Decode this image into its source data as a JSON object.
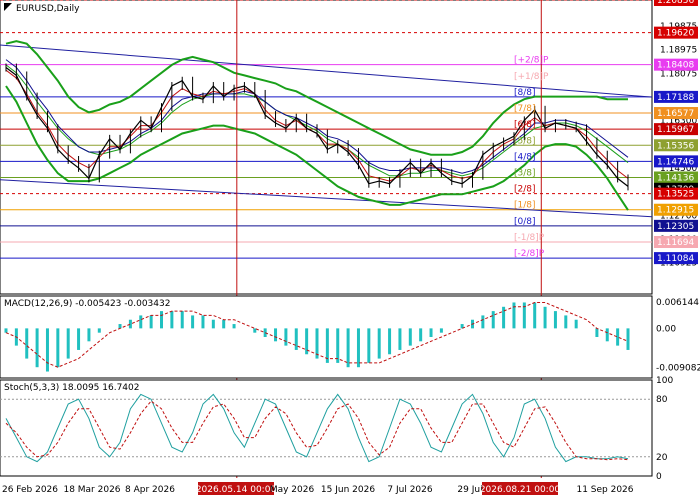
{
  "chart_data": [
    {
      "type": "line",
      "title": "EURUSD,Daily",
      "y_range": [
        1.09725,
        1.20856
      ],
      "x_date_range": [
        "2026-02-26",
        "2026-09-26"
      ],
      "price_axis_ticks": [
        "1.20856",
        "1.19875",
        "1.18975",
        "1.18075",
        "1.17188",
        "1.16300",
        "1.15400",
        "1.14500",
        "1.13709",
        "1.12700",
        "1.11800",
        "1.10925"
      ],
      "level_labels": [
        {
          "price": 1.20856,
          "text": "1.20856",
          "color": "#d60000"
        },
        {
          "price": 1.1962,
          "text": "1.19620",
          "color": "#d60000"
        },
        {
          "price": 1.18408,
          "text": "1.18408",
          "color": "#e83cf0"
        },
        {
          "price": 1.17188,
          "text": "1.17188",
          "color": "#1818c8"
        },
        {
          "price": 1.16577,
          "text": "1.16577",
          "color": "#f09020"
        },
        {
          "price": 1.15967,
          "text": "1.15967",
          "color": "#c80000"
        },
        {
          "price": 1.15356,
          "text": "1.15356",
          "color": "#8ea030"
        },
        {
          "price": 1.14746,
          "text": "1.14746",
          "color": "#1818c8"
        },
        {
          "price": 1.14136,
          "text": "1.14136",
          "color": "#6aa020"
        },
        {
          "price": 1.13709,
          "text": "1.13709",
          "color": "#000000"
        },
        {
          "price": 1.13525,
          "text": "1.13525",
          "color": "#d60000"
        },
        {
          "price": 1.12915,
          "text": "1.12915",
          "color": "#f0a000"
        },
        {
          "price": 1.12305,
          "text": "1.12305",
          "color": "#101090"
        },
        {
          "price": 1.11694,
          "text": "1.11694",
          "color": "#f6a8b0"
        },
        {
          "price": 1.11084,
          "text": "1.11084",
          "color": "#1818c8"
        }
      ],
      "murrey_labels": [
        {
          "price": 1.18408,
          "text": "[+2/8]P",
          "color": "#e83cf0"
        },
        {
          "price": 1.17798,
          "text": "[+1/8]P",
          "color": "#f6a8b0"
        },
        {
          "price": 1.17188,
          "text": "[8/8]",
          "color": "#1818c8"
        },
        {
          "price": 1.16577,
          "text": "[7/8]",
          "color": "#f09020"
        },
        {
          "price": 1.15967,
          "text": "[6/8]",
          "color": "#c80000"
        },
        {
          "price": 1.15356,
          "text": "[5/8]",
          "color": "#8ea030"
        },
        {
          "price": 1.14746,
          "text": "[4/8]",
          "color": "#1818c8"
        },
        {
          "price": 1.14136,
          "text": "[3/8]",
          "color": "#6aa020"
        },
        {
          "price": 1.13525,
          "text": "[2/8]",
          "color": "#c80000"
        },
        {
          "price": 1.12915,
          "text": "[1/8]",
          "color": "#f09020"
        },
        {
          "price": 1.12305,
          "text": "[0/8]",
          "color": "#1818c8"
        },
        {
          "price": 1.11694,
          "text": "[-1/8]P",
          "color": "#f6a8b0"
        },
        {
          "price": 1.11084,
          "text": "[-2/8]P",
          "color": "#e83cf0"
        }
      ],
      "series": [
        {
          "kind": "close",
          "values": [
            1.183,
            1.18,
            1.172,
            1.165,
            1.16,
            1.152,
            1.148,
            1.145,
            1.141,
            1.15,
            1.156,
            1.152,
            1.158,
            1.163,
            1.16,
            1.168,
            1.176,
            1.178,
            1.172,
            1.171,
            1.176,
            1.172,
            1.175,
            1.176,
            1.173,
            1.165,
            1.162,
            1.16,
            1.164,
            1.16,
            1.158,
            1.152,
            1.154,
            1.151,
            1.146,
            1.139,
            1.14,
            1.139,
            1.143,
            1.147,
            1.143,
            1.147,
            1.143,
            1.14,
            1.139,
            1.142,
            1.15,
            1.153,
            1.155,
            1.157,
            1.163,
            1.167,
            1.16,
            1.162,
            1.161,
            1.16,
            1.155,
            1.15,
            1.146,
            1.141,
            1.138
          ]
        },
        {
          "kind": "tenkan",
          "values": [
            1.182,
            1.179,
            1.173,
            1.166,
            1.161,
            1.154,
            1.15,
            1.147,
            1.145,
            1.149,
            1.153,
            1.153,
            1.157,
            1.161,
            1.161,
            1.166,
            1.172,
            1.175,
            1.173,
            1.172,
            1.174,
            1.173,
            1.174,
            1.175,
            1.173,
            1.167,
            1.163,
            1.161,
            1.163,
            1.16,
            1.158,
            1.154,
            1.154,
            1.152,
            1.148,
            1.142,
            1.141,
            1.14,
            1.142,
            1.145,
            1.144,
            1.146,
            1.144,
            1.142,
            1.141,
            1.142,
            1.147,
            1.151,
            1.154,
            1.156,
            1.161,
            1.164,
            1.161,
            1.162,
            1.161,
            1.16,
            1.157,
            1.152,
            1.148,
            1.144,
            1.141
          ]
        },
        {
          "kind": "kijun",
          "values": [
            1.186,
            1.183,
            1.178,
            1.172,
            1.167,
            1.161,
            1.157,
            1.153,
            1.151,
            1.151,
            1.152,
            1.153,
            1.155,
            1.158,
            1.16,
            1.163,
            1.168,
            1.171,
            1.172,
            1.173,
            1.173,
            1.173,
            1.173,
            1.174,
            1.173,
            1.17,
            1.167,
            1.165,
            1.164,
            1.162,
            1.16,
            1.157,
            1.156,
            1.154,
            1.151,
            1.147,
            1.145,
            1.144,
            1.144,
            1.145,
            1.145,
            1.145,
            1.145,
            1.144,
            1.143,
            1.144,
            1.146,
            1.149,
            1.152,
            1.155,
            1.158,
            1.162,
            1.162,
            1.163,
            1.163,
            1.162,
            1.161,
            1.158,
            1.155,
            1.152,
            1.149
          ]
        },
        {
          "kind": "bb_mid",
          "values": [
            1.184,
            1.181,
            1.176,
            1.17,
            1.165,
            1.16,
            1.156,
            1.153,
            1.151,
            1.15,
            1.151,
            1.152,
            1.154,
            1.157,
            1.159,
            1.162,
            1.166,
            1.169,
            1.171,
            1.172,
            1.173,
            1.173,
            1.173,
            1.173,
            1.172,
            1.17,
            1.167,
            1.165,
            1.163,
            1.161,
            1.159,
            1.156,
            1.154,
            1.152,
            1.149,
            1.146,
            1.144,
            1.142,
            1.142,
            1.143,
            1.143,
            1.144,
            1.144,
            1.143,
            1.142,
            1.143,
            1.145,
            1.148,
            1.151,
            1.154,
            1.157,
            1.16,
            1.161,
            1.162,
            1.162,
            1.161,
            1.159,
            1.156,
            1.153,
            1.15,
            1.147
          ]
        },
        {
          "kind": "bb_upper",
          "values": [
            1.192,
            1.193,
            1.192,
            1.188,
            1.183,
            1.178,
            1.172,
            1.168,
            1.166,
            1.167,
            1.169,
            1.17,
            1.172,
            1.175,
            1.178,
            1.181,
            1.184,
            1.186,
            1.187,
            1.186,
            1.185,
            1.183,
            1.181,
            1.18,
            1.179,
            1.178,
            1.177,
            1.175,
            1.174,
            1.172,
            1.17,
            1.168,
            1.166,
            1.164,
            1.162,
            1.16,
            1.158,
            1.156,
            1.154,
            1.152,
            1.151,
            1.15,
            1.15,
            1.15,
            1.151,
            1.153,
            1.157,
            1.162,
            1.166,
            1.169,
            1.171,
            1.172,
            1.172,
            1.172,
            1.172,
            1.172,
            1.172,
            1.172,
            1.171,
            1.171,
            1.171
          ]
        },
        {
          "kind": "bb_lower",
          "values": [
            1.176,
            1.17,
            1.162,
            1.154,
            1.148,
            1.143,
            1.14,
            1.14,
            1.14,
            1.141,
            1.143,
            1.145,
            1.147,
            1.15,
            1.152,
            1.154,
            1.156,
            1.158,
            1.159,
            1.16,
            1.161,
            1.161,
            1.16,
            1.159,
            1.158,
            1.156,
            1.154,
            1.152,
            1.15,
            1.147,
            1.144,
            1.141,
            1.138,
            1.136,
            1.134,
            1.133,
            1.132,
            1.131,
            1.131,
            1.132,
            1.133,
            1.134,
            1.135,
            1.135,
            1.135,
            1.136,
            1.137,
            1.138,
            1.14,
            1.143,
            1.146,
            1.15,
            1.153,
            1.154,
            1.154,
            1.153,
            1.15,
            1.146,
            1.141,
            1.135,
            1.129
          ]
        }
      ],
      "price_channel": {
        "upper": [
          1.1915,
          1.1718
        ],
        "lower": [
          1.1405,
          1.1265
        ]
      },
      "vlines": [
        {
          "label": "2026.05.14 00:00",
          "date": "2026-05-14"
        },
        {
          "label": "2026.08.21 00:00",
          "date": "2026-08-21"
        }
      ],
      "x_tick_labels": [
        "26 Feb 2026",
        "18 Mar 2026",
        "8 Apr 2026",
        "2026.05.14 00:00",
        "May 2026",
        "15 Jun 2026",
        "7 Jul 2026",
        "29 Jul",
        "2026.08.21 00:00",
        "11 Sep 2026"
      ]
    },
    {
      "type": "bar",
      "title": "MACD(12,26,9) -0.005423 -0.003432",
      "y_ticks": [
        "0.006144",
        "0.00",
        "-0.009082"
      ],
      "y_range": [
        -0.0115,
        0.0075
      ],
      "series": [
        {
          "name": "MACD",
          "values": [
            -0.001,
            -0.004,
            -0.007,
            -0.009,
            -0.01,
            -0.009,
            -0.007,
            -0.005,
            -0.003,
            -0.001,
            0.0,
            0.001,
            0.002,
            0.003,
            0.003,
            0.004,
            0.004,
            0.004,
            0.003,
            0.003,
            0.002,
            0.002,
            0.001,
            0.0,
            -0.001,
            -0.002,
            -0.003,
            -0.004,
            -0.005,
            -0.006,
            -0.007,
            -0.008,
            -0.008,
            -0.009,
            -0.009,
            -0.008,
            -0.007,
            -0.006,
            -0.005,
            -0.004,
            -0.003,
            -0.002,
            -0.001,
            0.0,
            0.001,
            0.002,
            0.003,
            0.004,
            0.005,
            0.006,
            0.006,
            0.006,
            0.005,
            0.004,
            0.003,
            0.002,
            0.0,
            -0.002,
            -0.003,
            -0.004,
            -0.005
          ]
        },
        {
          "name": "Signal",
          "values": [
            -0.001,
            -0.002,
            -0.004,
            -0.006,
            -0.008,
            -0.009,
            -0.008,
            -0.007,
            -0.005,
            -0.003,
            -0.001,
            0.0,
            0.001,
            0.002,
            0.003,
            0.003,
            0.004,
            0.004,
            0.004,
            0.003,
            0.003,
            0.002,
            0.002,
            0.001,
            0.0,
            -0.001,
            -0.002,
            -0.003,
            -0.004,
            -0.005,
            -0.006,
            -0.007,
            -0.007,
            -0.008,
            -0.008,
            -0.008,
            -0.008,
            -0.007,
            -0.006,
            -0.005,
            -0.004,
            -0.003,
            -0.002,
            -0.001,
            0.0,
            0.001,
            0.002,
            0.003,
            0.004,
            0.005,
            0.005,
            0.006,
            0.006,
            0.005,
            0.004,
            0.003,
            0.002,
            0.0,
            -0.001,
            -0.002,
            -0.003
          ]
        }
      ]
    },
    {
      "type": "line",
      "title": "Stoch(5,3,3) 18.0095 16.7402",
      "y_ticks": [
        "100",
        "80",
        "20",
        "0"
      ],
      "y_range": [
        0,
        100
      ],
      "series": [
        {
          "name": "Main",
          "values": [
            60,
            40,
            20,
            15,
            25,
            50,
            75,
            80,
            60,
            30,
            20,
            35,
            70,
            85,
            80,
            55,
            30,
            25,
            45,
            75,
            85,
            70,
            45,
            30,
            55,
            80,
            75,
            50,
            25,
            20,
            45,
            70,
            85,
            70,
            40,
            15,
            20,
            50,
            80,
            75,
            55,
            30,
            25,
            50,
            75,
            85,
            65,
            35,
            20,
            40,
            75,
            80,
            60,
            30,
            15,
            20,
            20,
            18,
            18,
            20,
            18
          ]
        },
        {
          "name": "Signal",
          "values": [
            55,
            45,
            30,
            20,
            22,
            35,
            55,
            70,
            70,
            50,
            30,
            28,
            45,
            65,
            78,
            70,
            50,
            35,
            35,
            55,
            72,
            75,
            60,
            40,
            40,
            60,
            72,
            65,
            45,
            30,
            32,
            50,
            70,
            75,
            60,
            35,
            22,
            30,
            55,
            70,
            70,
            50,
            35,
            35,
            55,
            75,
            75,
            55,
            35,
            30,
            50,
            70,
            72,
            55,
            35,
            20,
            18,
            18,
            17,
            18,
            17
          ]
        }
      ],
      "levels": [
        80,
        20
      ]
    }
  ]
}
